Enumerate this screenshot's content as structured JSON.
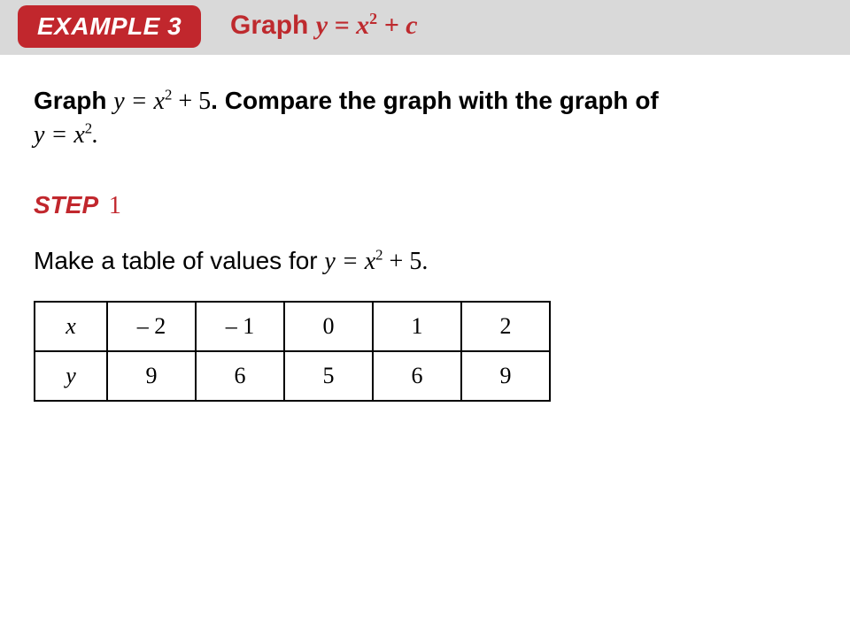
{
  "badge": {
    "label": "EXAMPLE 3"
  },
  "title": {
    "prefix": "Graph ",
    "eq_lhs": "y = x",
    "eq_exp": "2",
    "eq_rhs": " + c"
  },
  "instruction": {
    "part1_bold": "Graph ",
    "eq1_lhs": "y = x",
    "eq1_exp": "2",
    "eq1_rhs": " + 5",
    "part2_bold": ". Compare the graph with the graph of",
    "eq2_lhs": "y = x",
    "eq2_exp": "2",
    "eq2_tail": "."
  },
  "step": {
    "label": "STEP",
    "number": "1"
  },
  "make": {
    "part1_bold": "Make a table of values for ",
    "eq_lhs": "y = x",
    "eq_exp": "2",
    "eq_rhs": " + 5."
  },
  "table": {
    "row_x_label": "x",
    "row_y_label": "y",
    "x": [
      "– 2",
      "– 1",
      "0",
      "1",
      "2"
    ],
    "y": [
      "9",
      "6",
      "5",
      "6",
      "9"
    ]
  },
  "chart_data": {
    "type": "table",
    "title": "Values for y = x^2 + 5",
    "columns": [
      "x",
      "y"
    ],
    "rows": [
      {
        "x": -2,
        "y": 9
      },
      {
        "x": -1,
        "y": 6
      },
      {
        "x": 0,
        "y": 5
      },
      {
        "x": 1,
        "y": 6
      },
      {
        "x": 2,
        "y": 9
      }
    ]
  }
}
